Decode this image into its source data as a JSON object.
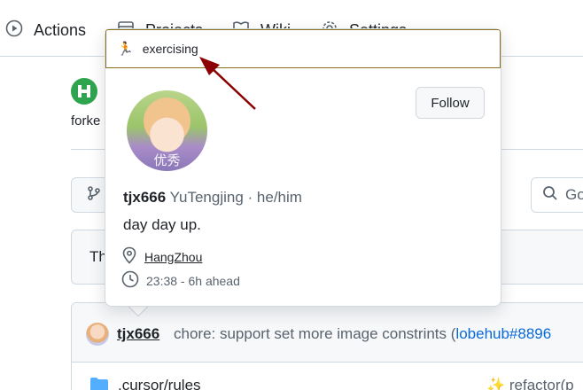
{
  "repo_tabs": [
    {
      "label": "Actions",
      "icon": "play-circle-icon"
    },
    {
      "label": "Projects",
      "icon": "table-icon"
    },
    {
      "label": "Wiki",
      "icon": "book-icon"
    },
    {
      "label": "Settings",
      "icon": "gear-icon"
    }
  ],
  "fork_text": "forke",
  "goto_placeholder": "Go",
  "info_banner_text": "Th",
  "latest_commit": {
    "author": "tjx666",
    "message": "chore: support set more image constrints (",
    "link": "lobehub#8896"
  },
  "files": [
    {
      "name": ".cursor/rules",
      "commit": "✨ refactor(p"
    }
  ],
  "hovercard": {
    "status_emoji": "🏃",
    "status_text": "exercising",
    "follow_label": "Follow",
    "avatar_caption": "优秀",
    "login": "tjx666",
    "fullname": "YuTengjing · he/him",
    "bio": "day day up.",
    "location": "HangZhou",
    "local_time": "23:38 - 6h ahead"
  },
  "colors": {
    "status_border": "#8a6d1f",
    "annotation_arrow": "#8b0000",
    "link": "#0969da"
  }
}
